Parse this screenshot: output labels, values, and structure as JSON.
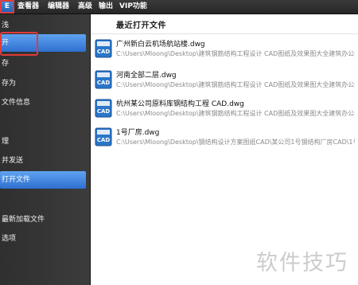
{
  "menubar": {
    "file_tab": "E",
    "items": [
      "查看器",
      "编辑器",
      "高级",
      "输出",
      "VIP功能"
    ]
  },
  "left_menu": {
    "items": [
      {
        "label": "浅"
      },
      {
        "label": "开"
      },
      {
        "label": "存"
      },
      {
        "label": "存为"
      },
      {
        "label": "文件信息"
      },
      {
        "label": "理"
      },
      {
        "label": "并发送"
      },
      {
        "label": "打开文件"
      },
      {
        "label": "最新加载文件"
      },
      {
        "label": "选项"
      }
    ]
  },
  "recent": {
    "title": "最近打开文件",
    "files": [
      {
        "name": "广州新白云机场航站楼.dwg",
        "path": "C:\\Users\\Mloong\\Desktop\\建筑钢筋结构工程设计 CAD图纸及效果图大全建筑办公楼厂"
      },
      {
        "name": "河南全部二层.dwg",
        "path": "C:\\Users\\Mloong\\Desktop\\建筑钢筋结构工程设计 CAD图纸及效果图大全建筑办公楼厂"
      },
      {
        "name": "杭州某公司原料库钢结构工程 CAD.dwg",
        "path": "C:\\Users\\Mloong\\Desktop\\建筑钢筋结构工程设计 CAD图纸及效果图大全建筑办公楼厂"
      },
      {
        "name": "1号厂房.dwg",
        "path": "C:\\Users\\Mloong\\Desktop\\钢结构设计方案图纸CAD\\某公司1号钢结构厂房CAD\\1号厂"
      }
    ],
    "icon_label": "CAD",
    "icon_name": "cad-file-icon"
  },
  "watermark": "软件技巧",
  "colors": {
    "menubar_bg": "#2b2b2b",
    "accent_blue": "#2f6fd0",
    "highlight_red": "#e23b3b"
  }
}
